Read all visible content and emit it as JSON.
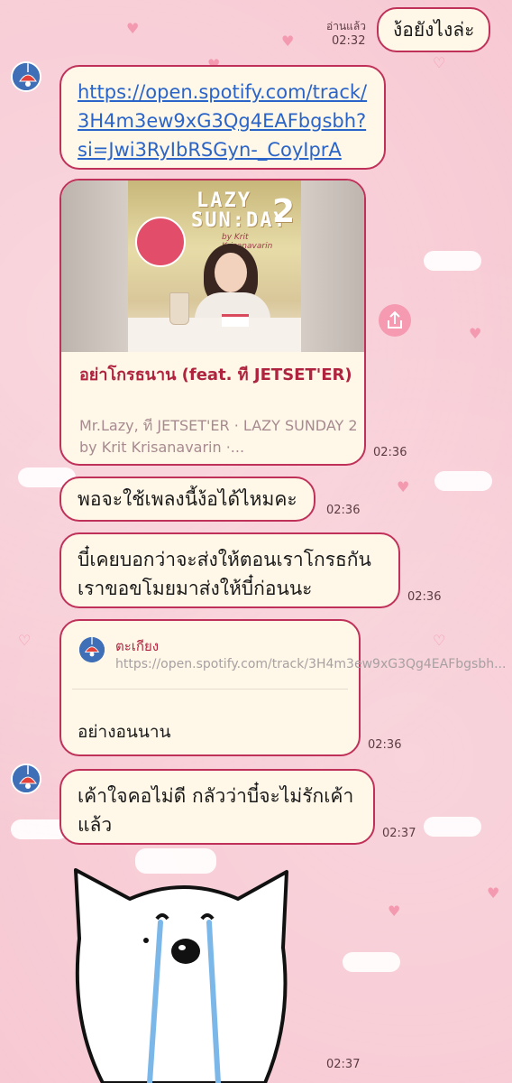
{
  "messages": {
    "sent_1": {
      "text": "ง้อยังไงล่ะ",
      "read_label": "อ่านแล้ว",
      "time": "02:32"
    },
    "link_msg": {
      "url_lines": [
        "https://open.spotify.com/track/",
        "3H4m3ew9xG3Qg4EAFbgsbh?",
        "si=Jwi3RyIbRSGyn-_CoyIprA"
      ]
    },
    "card": {
      "album_title_a": "LAZY",
      "album_title_b": "SUN:DAY",
      "album_num": "2",
      "album_byline": "by Krit Krisanavarin",
      "title": "อย่าโกรธนาน (feat. ที JETSET'ER)",
      "subtitle": "Mr.Lazy, ที JETSET'ER · LAZY SUNDAY 2 by Krit Krisanavarin ·...",
      "time": "02:36"
    },
    "msg_2": {
      "text": "พอจะใช้เพลงนี้ง้อได้ไหมคะ",
      "time": "02:36"
    },
    "msg_3": {
      "line1": "บี๋เคยบอกว่าจะส่งให้ตอนเราโกรธกัน",
      "line2": "เราขอขโมยมาส่งให้บี๋ก่อนนะ",
      "time": "02:36"
    },
    "reply": {
      "quoted_name": "ตะเกียง",
      "quoted_text": "https://open.spotify.com/track/3H4m3ew9xG3Qg4EAFbgsbh...",
      "text": "อย่างอนนาน",
      "time": "02:36"
    },
    "msg_4": {
      "line1": "เค้าใจคอไม่ดี กลัวว่าบี๋จะไม่รักเค้า",
      "line2": "แล้ว",
      "time": "02:37"
    },
    "sticker": {
      "time": "02:37"
    }
  },
  "colors": {
    "bubble_border": "#c0315a",
    "bubble_bg": "#fff8e8",
    "background": "#f7c9d3",
    "link": "#2a64c8",
    "title_red": "#b0233f"
  },
  "icons": {
    "avatar": "lamp-avatar-icon",
    "share": "share-icon"
  }
}
